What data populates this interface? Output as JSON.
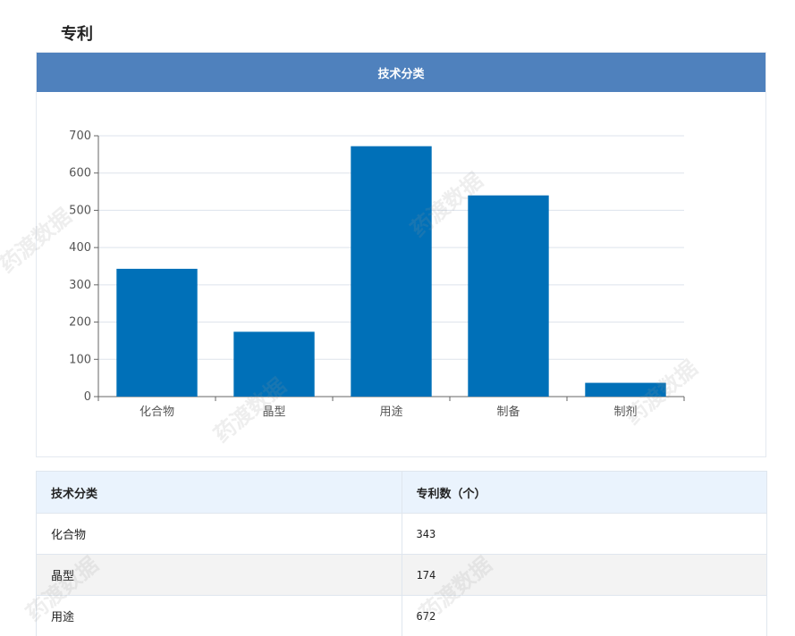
{
  "section": {
    "title": "专利"
  },
  "chart_card": {
    "header": "技术分类"
  },
  "watermark": {
    "text": "药渡数据"
  },
  "colors": {
    "header_bg": "#4f81bd",
    "bar": "#0070b8",
    "table_header_bg": "#eaf3fd",
    "row_alt_bg": "#f3f3f3"
  },
  "chart_data": {
    "type": "bar",
    "categories": [
      "化合物",
      "晶型",
      "用途",
      "制备",
      "制剂"
    ],
    "values": [
      343,
      174,
      672,
      540,
      37
    ],
    "ylim": [
      0,
      700
    ],
    "yticks": [
      0,
      100,
      200,
      300,
      400,
      500,
      600,
      700
    ],
    "grid": true,
    "title": "",
    "xlabel": "",
    "ylabel": ""
  },
  "table": {
    "headers": [
      "技术分类",
      "专利数（个）"
    ],
    "rows": [
      [
        "化合物",
        "343"
      ],
      [
        "晶型",
        "174"
      ],
      [
        "用途",
        "672"
      ]
    ]
  }
}
